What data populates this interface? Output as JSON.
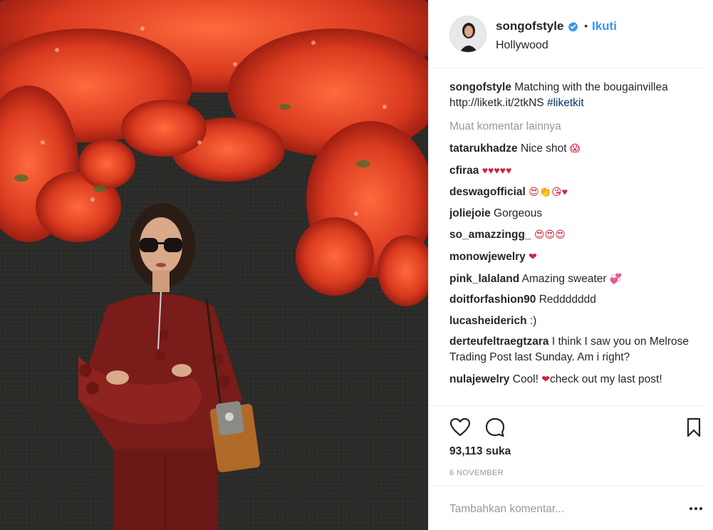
{
  "post": {
    "username": "songofstyle",
    "follow_label": "Ikuti",
    "location": "Hollywood",
    "caption": {
      "user": "songofstyle",
      "text": "Matching with the bougainvillea http://liketk.it/2tkNS ",
      "hashtag": "#liketkit"
    },
    "load_more": "Muat komentar lainnya",
    "comments": [
      {
        "user": "tatarukhadze",
        "text": "Nice shot",
        "emoji": "😱"
      },
      {
        "user": "cfiraa",
        "text": "",
        "emoji": "♥♥♥♥♥"
      },
      {
        "user": "deswagofficial",
        "text": "",
        "emoji": "😍👏😘♥"
      },
      {
        "user": "joliejoie",
        "text": "Gorgeous",
        "emoji": ""
      },
      {
        "user": "so_amazzingg_",
        "text": "",
        "emoji": "😍😍😍"
      },
      {
        "user": "monowjewelry",
        "text": "",
        "emoji": "❤"
      },
      {
        "user": "pink_lalaland",
        "text": "Amazing sweater",
        "emoji": "💞"
      },
      {
        "user": "doitforfashion90",
        "text": "Reddddddd",
        "emoji": ""
      },
      {
        "user": "lucasheiderich",
        "text": ":)",
        "emoji": ""
      },
      {
        "user": "derteufeltraegtzara",
        "text": "I think I saw you on Melrose Trading Post last Sunday. Am i right?",
        "emoji": ""
      },
      {
        "user": "nulajewelry",
        "text": "Cool!",
        "emoji": "❤",
        "text_after": "check out my last post!"
      }
    ],
    "likes": "93,113 suka",
    "date": "6 NOVEMBER",
    "comment_placeholder": "Tambahkan komentar...",
    "icons": {
      "like": "heart-outline-icon",
      "comment": "speech-bubble-icon",
      "save": "bookmark-icon",
      "verified": "verified-badge-icon",
      "more": "more-options-icon"
    },
    "colors": {
      "link_blue": "#3897f0",
      "hashtag": "#003569",
      "muted": "#999999",
      "text": "#262626"
    }
  }
}
